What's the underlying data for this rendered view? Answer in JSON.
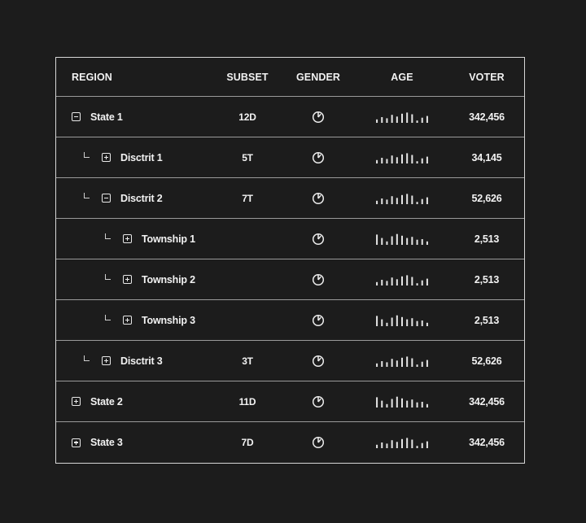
{
  "headers": {
    "region": "REGION",
    "subset": "SUBSET",
    "gender": "GENDER",
    "age": "AGE",
    "voter": "VOTER"
  },
  "icons": {
    "expanded": "minus-square-icon",
    "collapsed": "plus-square-icon",
    "gender": "pie-chart-icon",
    "age": "bar-sparkline-icon",
    "tree": "tree-elbow-icon"
  },
  "colors": {
    "background": "#1c1c1c",
    "text": "#f2f2f2",
    "border": "#d6d6d6"
  },
  "rows": [
    {
      "label": "State 1",
      "level": 0,
      "expanded": true,
      "subset": "12D",
      "voter": "342,456",
      "age_bars": [
        0.3,
        0.5,
        0.4,
        0.7,
        0.55,
        0.8,
        0.9,
        0.75,
        0.2,
        0.45,
        0.6
      ]
    },
    {
      "label": "Disctrit 1",
      "level": 1,
      "expanded": false,
      "subset": "5T",
      "voter": "34,145",
      "age_bars": [
        0.3,
        0.5,
        0.4,
        0.7,
        0.55,
        0.8,
        0.9,
        0.75,
        0.2,
        0.45,
        0.6
      ]
    },
    {
      "label": "Disctrit 2",
      "level": 1,
      "expanded": true,
      "subset": "7T",
      "voter": "52,626",
      "age_bars": [
        0.3,
        0.5,
        0.4,
        0.7,
        0.55,
        0.8,
        0.9,
        0.75,
        0.2,
        0.45,
        0.6
      ]
    },
    {
      "label": "Township 1",
      "level": 2,
      "expanded": false,
      "subset": "",
      "voter": "2,513",
      "age_bars": [
        0.9,
        0.6,
        0.3,
        0.75,
        0.95,
        0.8,
        0.6,
        0.7,
        0.45,
        0.5,
        0.3
      ]
    },
    {
      "label": "Township 2",
      "level": 2,
      "expanded": false,
      "subset": "",
      "voter": "2,513",
      "age_bars": [
        0.3,
        0.5,
        0.4,
        0.7,
        0.55,
        0.8,
        0.9,
        0.75,
        0.2,
        0.45,
        0.6
      ]
    },
    {
      "label": "Township 3",
      "level": 2,
      "expanded": false,
      "subset": "",
      "voter": "2,513",
      "age_bars": [
        0.9,
        0.6,
        0.3,
        0.75,
        0.95,
        0.8,
        0.6,
        0.7,
        0.45,
        0.5,
        0.3
      ]
    },
    {
      "label": "Disctrit 3",
      "level": 1,
      "expanded": false,
      "subset": "3T",
      "voter": "52,626",
      "age_bars": [
        0.3,
        0.5,
        0.4,
        0.7,
        0.55,
        0.8,
        0.9,
        0.75,
        0.2,
        0.45,
        0.6
      ]
    },
    {
      "label": "State 2",
      "level": 0,
      "expanded": false,
      "subset": "11D",
      "voter": "342,456",
      "age_bars": [
        0.9,
        0.6,
        0.3,
        0.75,
        0.95,
        0.8,
        0.6,
        0.7,
        0.45,
        0.5,
        0.3
      ]
    },
    {
      "label": "State 3",
      "level": 0,
      "expanded": false,
      "subset": "7D",
      "voter": "342,456",
      "age_bars": [
        0.3,
        0.5,
        0.4,
        0.7,
        0.55,
        0.8,
        0.9,
        0.75,
        0.2,
        0.45,
        0.6
      ]
    }
  ]
}
